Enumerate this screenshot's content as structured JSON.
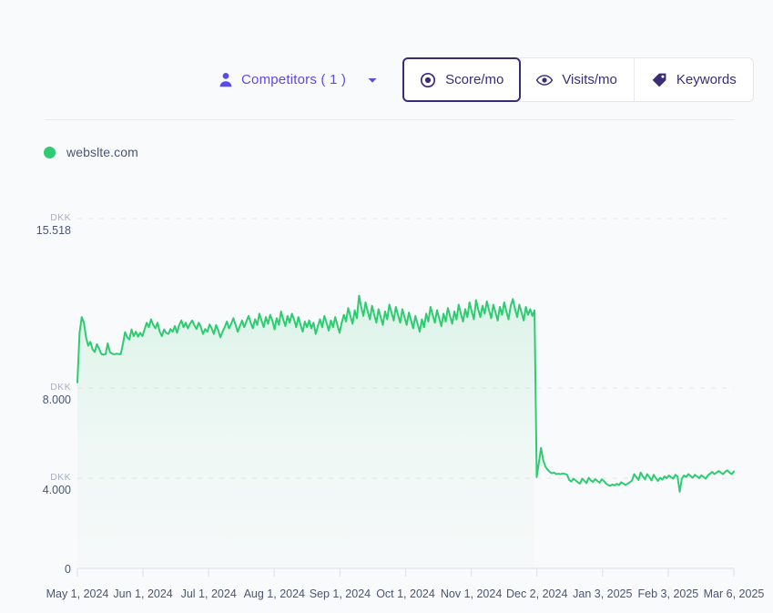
{
  "toolbar": {
    "competitors": {
      "label": "Competitors ( 1 )",
      "icon": "person-icon",
      "chevron": "chevron-down-icon"
    },
    "tabs": [
      {
        "label": "Score/mo",
        "icon": "target-icon",
        "selected": true
      },
      {
        "label": "Visits/mo",
        "icon": "eye-icon",
        "selected": false
      },
      {
        "label": "Keywords",
        "icon": "tag-icon",
        "selected": false
      }
    ]
  },
  "legend": {
    "items": [
      {
        "label": "webslte.com",
        "color": "#2ecc71"
      }
    ]
  },
  "colors": {
    "series_green": "#2ecc71",
    "accent_purple": "#5b4be0",
    "tab_text": "#3b2c77",
    "grid": "#e3e6ef",
    "background": "#f9fafc"
  },
  "chart_data": {
    "type": "area",
    "title": "",
    "xlabel": "",
    "ylabel": "DKK",
    "unit": "DKK",
    "ylim": [
      0,
      15518
    ],
    "grid": true,
    "legend_position": "top-left",
    "y_ticks": [
      {
        "unit": "DKK",
        "value": "15.518",
        "num": 15518
      },
      {
        "unit": "DKK",
        "value": "8.000",
        "num": 8000
      },
      {
        "unit": "DKK",
        "value": "4.000",
        "num": 4000
      },
      {
        "unit": "",
        "value": "0",
        "num": 0
      }
    ],
    "x_ticks": [
      "May 1, 2024",
      "Jun 1, 2024",
      "Jul 1, 2024",
      "Aug 1, 2024",
      "Sep 1, 2024",
      "Oct 1, 2024",
      "Nov 1, 2024",
      "Dec 2, 2024",
      "Jan 3, 2025",
      "Feb 3, 2025",
      "Mar 6, 2025"
    ],
    "series": [
      {
        "name": "webslte.com",
        "color": "#2ecc71",
        "values": [
          8250,
          10450,
          11150,
          10900,
          10250,
          9880,
          10050,
          9720,
          9600,
          9950,
          9750,
          9520,
          9480,
          9500,
          9980,
          9600,
          9530,
          9500,
          9520,
          9510,
          9500,
          9950,
          10480,
          10250,
          10150,
          10600,
          10300,
          10500,
          10280,
          10450,
          10300,
          10600,
          10900,
          10700,
          11050,
          10800,
          10650,
          10900,
          10500,
          10300,
          10600,
          10450,
          10400,
          10620,
          10500,
          10750,
          10450,
          10800,
          11000,
          10700,
          10900,
          10650,
          10850,
          11000,
          10780,
          10620,
          10900,
          10700,
          10400,
          10620,
          10500,
          10820,
          10650,
          10400,
          10800,
          10560,
          10250,
          10500,
          10700,
          10950,
          10650,
          10850,
          11100,
          10800,
          10500,
          10750,
          11000,
          10700,
          10950,
          11200,
          10900,
          10650,
          11050,
          10800,
          11300,
          11000,
          10700,
          11150,
          10850,
          11250,
          11000,
          10600,
          11100,
          10800,
          11400,
          11050,
          10750,
          11200,
          10900,
          11300,
          11050,
          10700,
          11150,
          10800,
          10500,
          10950,
          10700,
          11000,
          10650,
          10900,
          10400,
          10750,
          11050,
          10700,
          11200,
          10900,
          10550,
          11000,
          10700,
          11150,
          10800,
          10450,
          10900,
          11250,
          10950,
          11550,
          11200,
          10850,
          11450,
          11100,
          12100,
          11600,
          11200,
          11800,
          11400,
          11050,
          11650,
          11250,
          10900,
          11500,
          11150,
          10800,
          11400,
          11050,
          11700,
          11350,
          11000,
          11600,
          11250,
          10900,
          11500,
          11150,
          10800,
          11350,
          11000,
          10650,
          11200,
          10850,
          10500,
          11050,
          10700,
          11300,
          10950,
          11600,
          11250,
          10900,
          11450,
          11100,
          10750,
          11300,
          10950,
          11550,
          11200,
          10850,
          11400,
          11050,
          11700,
          11300,
          10950,
          11500,
          11150,
          11800,
          11400,
          11050,
          11900,
          11500,
          11150,
          11650,
          11300,
          11850,
          11450,
          11100,
          11700,
          11350,
          11000,
          11600,
          11250,
          11800,
          11400,
          11050,
          11650,
          11950,
          11500,
          11150,
          11700,
          11350,
          11000,
          11600,
          11250,
          11500,
          11200,
          11450,
          4050,
          4680,
          5350,
          4800,
          4520,
          4380,
          4280,
          4220,
          4250,
          4180,
          4200,
          4180,
          4210,
          4190,
          4160,
          3920,
          3850,
          3980,
          3900,
          3820,
          3760,
          3980,
          3880,
          3780,
          4020,
          3900,
          3840,
          3960,
          3880,
          3800,
          3950,
          3880,
          3760,
          3700,
          3660,
          3720,
          3680,
          3750,
          3700,
          3820,
          3760,
          3700,
          3760,
          3820,
          3900,
          4180,
          4050,
          3920,
          4250,
          4080,
          3950,
          4180,
          4050,
          3900,
          4150,
          4000,
          3880,
          4020,
          3940,
          4080,
          4000,
          4120,
          4050,
          3980,
          4150,
          4080,
          3400,
          3980,
          4120,
          4050,
          4180,
          4100,
          4020,
          4150,
          4080,
          4000,
          4130,
          4060,
          3980,
          4120,
          4200,
          4280,
          4180,
          4250,
          4320,
          4250,
          4180,
          4280,
          4350,
          4250,
          4180,
          4300
        ]
      }
    ],
    "annotations": [
      {
        "type": "drop",
        "at": "Dec 2, 2024",
        "from": 11450,
        "to": 4050
      }
    ]
  }
}
